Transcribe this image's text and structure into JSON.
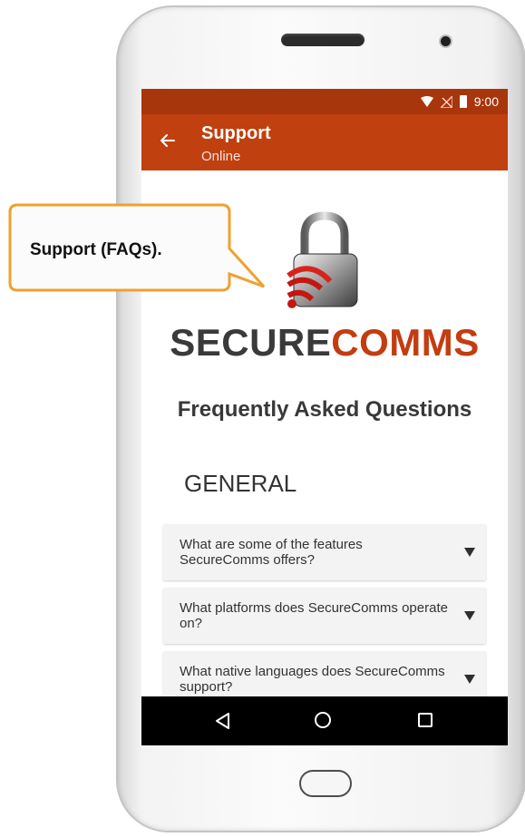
{
  "status_bar": {
    "time": "9:00"
  },
  "app_bar": {
    "title": "Support",
    "subtitle": "Online"
  },
  "brand": {
    "secure": "SECURE",
    "comms": "COMMS"
  },
  "faq": {
    "heading": "Frequently Asked Questions",
    "section": "GENERAL",
    "items": [
      {
        "question": "What are some of the features SecureComms offers?"
      },
      {
        "question": "What platforms does SecureComms operate on?"
      },
      {
        "question": "What native languages does SecureComms support?"
      }
    ]
  },
  "callout": {
    "text": "Support (FAQs)."
  },
  "colors": {
    "status_bar": "#a8360c",
    "app_bar": "#c0400f",
    "brand_accent": "#c23d10",
    "callout_border": "#f0a030"
  },
  "icons": {
    "back": "arrow-left-icon",
    "expand": "chevron-down-icon",
    "lock": "padlock-signal-icon",
    "nav_back": "triangle-back-icon",
    "nav_home": "circle-home-icon",
    "nav_recent": "square-recents-icon"
  }
}
